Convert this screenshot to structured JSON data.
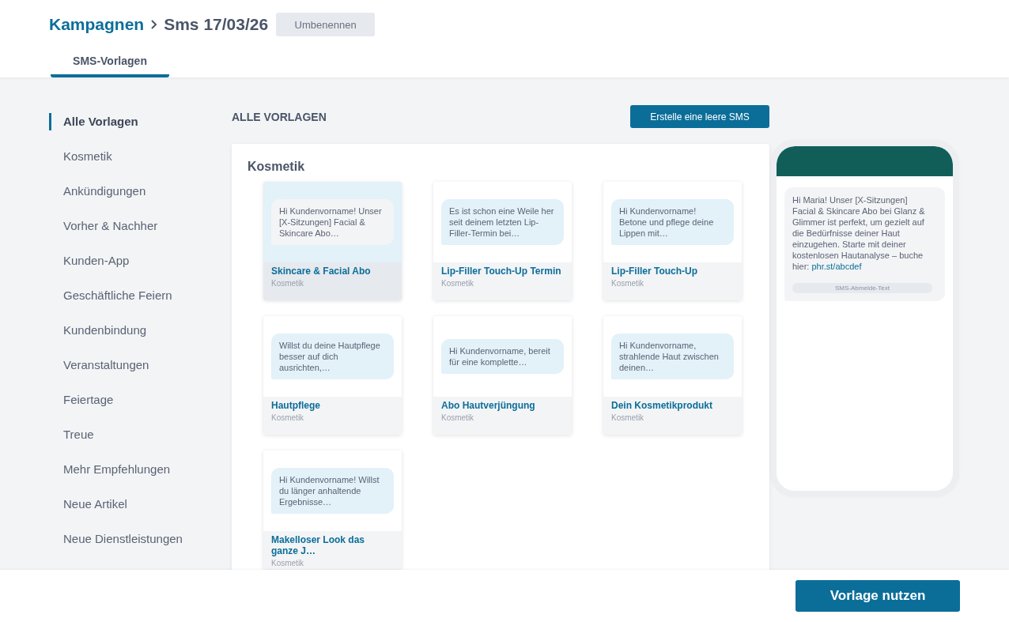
{
  "header": {
    "breadcrumb": [
      {
        "label": "Kampagnen",
        "kind": "link"
      },
      {
        "label": "Sms 17/03/26",
        "kind": "current"
      }
    ],
    "rename_button": "Umbenennen"
  },
  "tabs": [
    {
      "label": "SMS-Vorlagen",
      "selected": true
    }
  ],
  "sidebar": {
    "items": [
      {
        "label": "Alle Vorlagen",
        "selected": true
      },
      {
        "label": "Kosmetik",
        "selected": false
      },
      {
        "label": "Ankündigungen",
        "selected": false
      },
      {
        "label": "Vorher & Nachher",
        "selected": false
      },
      {
        "label": "Kunden-App",
        "selected": false
      },
      {
        "label": "Geschäftliche Feiern",
        "selected": false
      },
      {
        "label": "Kundenbindung",
        "selected": false
      },
      {
        "label": "Veranstaltungen",
        "selected": false
      },
      {
        "label": "Feiertage",
        "selected": false
      },
      {
        "label": "Treue",
        "selected": false
      },
      {
        "label": "Mehr Empfehlungen",
        "selected": false
      },
      {
        "label": "Neue Artikel",
        "selected": false
      },
      {
        "label": "Neue Dienstleistungen",
        "selected": false
      }
    ]
  },
  "content": {
    "heading": "ALLE VORLAGEN",
    "create_button": "Erstelle eine leere SMS",
    "section_title": "Kosmetik",
    "cards": [
      {
        "preview": "Hi Kundenvorname! Unser [X-Sitzungen] Facial & Skincare Abo…",
        "title": "Skincare & Facial Abo",
        "category": "Kosmetik",
        "selected": true
      },
      {
        "preview": "Es ist schon eine Weile her seit deinem letzten Lip-Filler-Termin bei…",
        "title": "Lip-Filler Touch-Up Termin",
        "category": "Kosmetik",
        "selected": false
      },
      {
        "preview": "Hi Kundenvorname! Betone und pflege deine Lippen mit…",
        "title": "Lip-Filler Touch-Up",
        "category": "Kosmetik",
        "selected": false
      },
      {
        "preview": "Willst du deine Hautpflege besser auf dich ausrichten,…",
        "title": "Hautpflege",
        "category": "Kosmetik",
        "selected": false
      },
      {
        "preview": "Hi Kundenvorname, bereit für eine komplette…",
        "title": "Abo Hautverjüngung",
        "category": "Kosmetik",
        "selected": false
      },
      {
        "preview": "Hi Kundenvorname, strahlende Haut zwischen deinen…",
        "title": "Dein Kosmetikprodukt",
        "category": "Kosmetik",
        "selected": false
      },
      {
        "preview": "Hi Kundenvorname! Willst du länger anhaltende Ergebnisse…",
        "title": "Makelloser Look das ganze J…",
        "category": "Kosmetik",
        "selected": false
      }
    ]
  },
  "preview": {
    "message": "Hi Maria! Unser [X-Sitzungen] Facial & Skincare Abo bei Glanz & Glimmer ist perfekt, um gezielt auf die Bedürfnisse deiner Haut einzugehen. Starte mit deiner kostenlosen Hautanalyse – buche hier: ",
    "link": "phr.st/abcdef",
    "unsubscribe": "SMS-Abmelde-Text"
  },
  "footer": {
    "button": "Vorlage nutzen"
  }
}
